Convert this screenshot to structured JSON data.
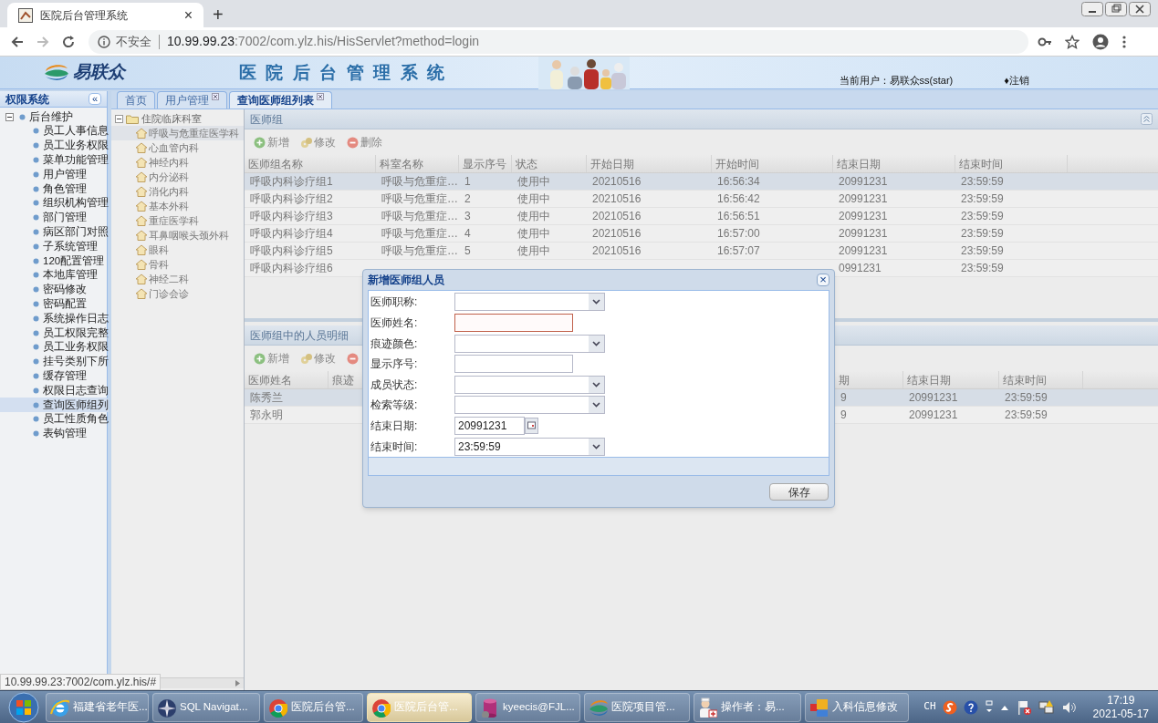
{
  "browser": {
    "tab_title": "医院后台管理系统",
    "tab_close": "×",
    "new_tab": "+",
    "security": "不安全",
    "url_host": "10.99.99.23",
    "url_path": ":7002/com.ylz.his/HisServlet?method=login"
  },
  "header": {
    "logo": "易联众",
    "title": "医院后台管理系统",
    "current_user": "当前用户：易联众ss(star)",
    "logout": "♦注销"
  },
  "sidebar": {
    "title": "权限系统",
    "collapse": "«",
    "tree": [
      {
        "label": "后台维护",
        "expanded": true,
        "children": [
          {
            "label": "员工人事信息",
            "selected": false
          },
          {
            "label": "员工业务权限",
            "selected": false
          },
          {
            "label": "菜单功能管理",
            "selected": false
          },
          {
            "label": "用户管理",
            "selected": false
          },
          {
            "label": "角色管理",
            "selected": false
          },
          {
            "label": "组织机构管理",
            "selected": false
          },
          {
            "label": "部门管理",
            "selected": false
          },
          {
            "label": "病区部门对照",
            "selected": false
          },
          {
            "label": "子系统管理",
            "selected": false
          },
          {
            "label": "120配置管理",
            "selected": false
          },
          {
            "label": "本地库管理",
            "selected": false
          },
          {
            "label": "密码修改",
            "selected": false
          },
          {
            "label": "密码配置",
            "selected": false
          },
          {
            "label": "系统操作日志",
            "selected": false
          },
          {
            "label": "员工权限完整",
            "selected": false
          },
          {
            "label": "员工业务权限",
            "selected": false
          },
          {
            "label": "挂号类别下所",
            "selected": false
          },
          {
            "label": "缓存管理",
            "selected": false
          },
          {
            "label": "权限日志查询",
            "selected": false
          },
          {
            "label": "查询医师组列",
            "selected": true
          },
          {
            "label": "员工性质角色",
            "selected": false
          },
          {
            "label": "表钩管理",
            "selected": false
          }
        ]
      }
    ]
  },
  "tabs": [
    {
      "label": "首页",
      "closable": false,
      "selected": false
    },
    {
      "label": "用户管理",
      "closable": true,
      "selected": false
    },
    {
      "label": "查询医师组列表",
      "closable": true,
      "selected": true
    }
  ],
  "dept_tree": [
    {
      "label": "住院临床科室",
      "expanded": true,
      "children": [
        {
          "label": "呼吸与危重症医学科",
          "selected": true
        },
        {
          "label": "心血管内科",
          "selected": false
        },
        {
          "label": "神经内科",
          "selected": false
        },
        {
          "label": "内分泌科",
          "selected": false
        },
        {
          "label": "消化内科",
          "selected": false
        },
        {
          "label": "基本外科",
          "selected": false
        },
        {
          "label": "重症医学科",
          "selected": false
        },
        {
          "label": "耳鼻咽喉头颈外科",
          "selected": false
        },
        {
          "label": "眼科",
          "selected": false
        },
        {
          "label": "骨科",
          "selected": false
        },
        {
          "label": "神经二科",
          "selected": false
        },
        {
          "label": "门诊会诊",
          "selected": false
        }
      ]
    }
  ],
  "group_panel": {
    "title": "医师组",
    "toolbar": [
      {
        "kind": "add",
        "label": "新增"
      },
      {
        "kind": "edit",
        "label": "修改"
      },
      {
        "kind": "delete",
        "label": "删除"
      }
    ],
    "columns": [
      "医师组名称",
      "科室名称",
      "显示序号",
      "状态",
      "开始日期",
      "开始时间",
      "结束日期",
      "结束时间"
    ],
    "rows": [
      {
        "selected": true,
        "cells": {
          "name": "呼吸内科诊疗组1",
          "department": "呼吸与危重症…",
          "order": "1",
          "status": "使用中",
          "start_date": "20210516",
          "start_time": "16:56:34",
          "end_date": "20991231",
          "end_time": "23:59:59"
        }
      },
      {
        "selected": false,
        "cells": {
          "name": "呼吸内科诊疗组2",
          "department": "呼吸与危重症…",
          "order": "2",
          "status": "使用中",
          "start_date": "20210516",
          "start_time": "16:56:42",
          "end_date": "20991231",
          "end_time": "23:59:59"
        }
      },
      {
        "selected": false,
        "cells": {
          "name": "呼吸内科诊疗组3",
          "department": "呼吸与危重症…",
          "order": "3",
          "status": "使用中",
          "start_date": "20210516",
          "start_time": "16:56:51",
          "end_date": "20991231",
          "end_time": "23:59:59"
        }
      },
      {
        "selected": false,
        "cells": {
          "name": "呼吸内科诊疗组4",
          "department": "呼吸与危重症…",
          "order": "4",
          "status": "使用中",
          "start_date": "20210516",
          "start_time": "16:57:00",
          "end_date": "20991231",
          "end_time": "23:59:59"
        }
      },
      {
        "selected": false,
        "cells": {
          "name": "呼吸内科诊疗组5",
          "department": "呼吸与危重症…",
          "order": "5",
          "status": "使用中",
          "start_date": "20210516",
          "start_time": "16:57:07",
          "end_date": "20991231",
          "end_time": "23:59:59"
        }
      },
      {
        "selected": false,
        "cells": {
          "name": "呼吸内科诊疗组6",
          "end_date": "0991231",
          "end_time": "23:59:59"
        }
      }
    ]
  },
  "member_panel": {
    "title": "医师组中的人员明细",
    "toolbar": [
      {
        "kind": "add",
        "label": "新增"
      },
      {
        "kind": "edit",
        "label": "修改"
      },
      {
        "kind": "delete"
      }
    ],
    "columns": [
      "医师姓名",
      "痕迹",
      "期",
      "结束日期",
      "结束时间"
    ],
    "rows": [
      {
        "selected": true,
        "cells": {
          "name": "陈秀兰",
          "column_3": "9",
          "end_date": "20991231",
          "end_time": "23:59:59"
        }
      },
      {
        "selected": false,
        "cells": {
          "name": "郭永明",
          "column_3": "9",
          "end_date": "20991231",
          "end_time": "23:59:59"
        }
      }
    ]
  },
  "dialog": {
    "title": "新增医师组人员",
    "close": "×",
    "fields": [
      {
        "kind": "combo",
        "label": "医师职称:"
      },
      {
        "kind": "text",
        "label": "医师姓名:",
        "invalid": true
      },
      {
        "kind": "combo",
        "label": "痕迹颜色:"
      },
      {
        "kind": "text",
        "label": "显示序号:",
        "invalid": false
      },
      {
        "kind": "combo",
        "label": "成员状态:"
      },
      {
        "kind": "combo",
        "label": "检索等级:"
      },
      {
        "kind": "date",
        "label": "结束日期:",
        "value": "20991231"
      },
      {
        "kind": "combo",
        "label": "结束时间:",
        "value": "23:59:59"
      }
    ],
    "save": "保存"
  },
  "status_url": "10.99.99.23:7002/com.ylz.his/#",
  "taskbar": {
    "items": [
      {
        "kind": "ie",
        "label": "福建省老年医...",
        "selected": false
      },
      {
        "kind": "compass",
        "label": "SQL Navigat...",
        "selected": false
      },
      {
        "kind": "chrome",
        "label": "医院后台管...",
        "selected": false
      },
      {
        "kind": "chrome",
        "label": "医院后台管...",
        "selected": true
      },
      {
        "kind": "database",
        "label": "kyeecis@FJL...",
        "selected": false
      },
      {
        "kind": "swirl",
        "label": "医院项目管...",
        "selected": false
      },
      {
        "kind": "nurse",
        "label": "操作者：易...",
        "selected": false
      },
      {
        "kind": "blocks",
        "label": "入科信息修改",
        "selected": false
      }
    ],
    "language": "CH",
    "time": "17:19",
    "date": "2021-05-17"
  }
}
